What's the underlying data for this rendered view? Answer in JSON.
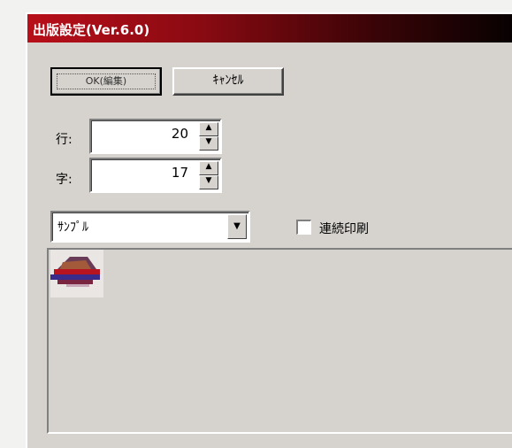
{
  "window": {
    "title": "出版設定(Ver.6.0)"
  },
  "buttons": {
    "ok_label": "OK(編集)",
    "cancel_label": "ｷｬﾝｾﾙ"
  },
  "fields": {
    "row1": {
      "label": "行:",
      "value": "20"
    },
    "row2": {
      "label": "字:",
      "value": "17"
    }
  },
  "combo": {
    "selected": "ｻﾝﾌﾟﾙ"
  },
  "checkbox": {
    "label": "連続印刷",
    "checked": false
  },
  "preview": {
    "image_description": "preview-image"
  },
  "icons": {
    "spin_up": "spin-up-icon",
    "spin_down": "spin-down-icon",
    "dropdown": "chevron-down-icon",
    "preview": "preview-thumbnail"
  },
  "colors": {
    "title_gradient_start": "#b80f1a",
    "title_gradient_end": "#050101",
    "face": "#d6d3ce"
  }
}
